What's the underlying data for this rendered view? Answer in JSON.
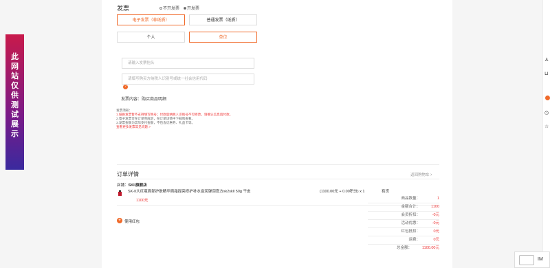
{
  "invoice": {
    "title": "发票",
    "option_no": "不开发票",
    "option_yes": "开发票",
    "type_electronic": "电子发票（非纸质）",
    "type_paper": "普通发票（纸质）",
    "title_personal": "个人",
    "title_company": "单位",
    "placeholder_title": "请输入发票抬头",
    "placeholder_tax": "请填写购买方纳税人识别号或统一社会信用代码",
    "help_icon": "?",
    "content_label": "发票内容：购买商品明细",
    "notes": {
      "heading": "发票须知：",
      "line1": "1.纸质发票暂不支持填写税号；付款后纳税人识别号不可修改，请确认信息后付款。",
      "line2": "2.电子发票可在订单完成后，在订单详情中下载和查看。",
      "line3": "3.发票金额为实际支付金额，不包含优惠券、礼品卡等。",
      "link": "查看更多发票常见问题 >"
    }
  },
  "order": {
    "title": "订单详情",
    "back_link": "返回购物车",
    "store_label": "店铺：",
    "store_name": "SKII旗舰店",
    "product_name": "SK-II大红瓶面部护肤精华面霜提亮修护补水滋润弹润官方sk2skll 50g 干皮",
    "price_line": "(1100.00元 + 0.00积分) x 1",
    "stock": "有货",
    "price": "1100元",
    "coupon_icon": "+",
    "coupon_label": "使用红包"
  },
  "summary": [
    {
      "k": "商品数量：",
      "v": "1"
    },
    {
      "k": "金额合计：",
      "v": "1100"
    },
    {
      "k": "会员折扣：",
      "v": "-0元"
    },
    {
      "k": "活动优惠：",
      "v": "-0元"
    },
    {
      "k": "红包抵扣：",
      "v": "0元"
    },
    {
      "k": "运费：",
      "v": "0元"
    },
    {
      "k": "总金额：",
      "v": "1100.00元"
    }
  ],
  "banner": {
    "text": "此网站仅供测试展示"
  },
  "im": {
    "label": "IM"
  },
  "colors": {
    "accent": "#f06a2a",
    "price": "#e33333"
  }
}
